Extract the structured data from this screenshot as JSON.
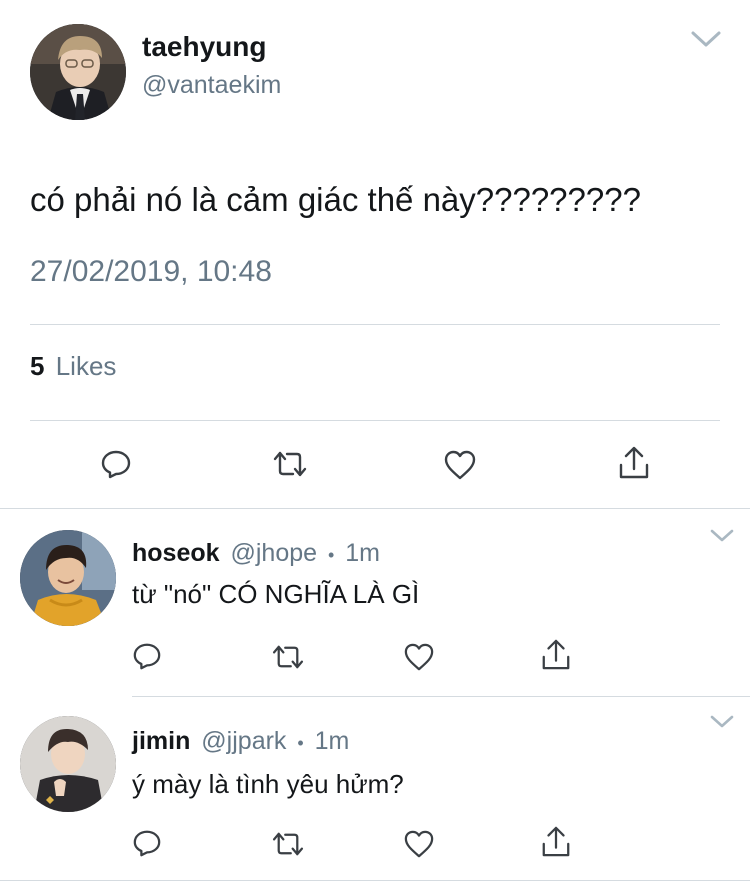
{
  "main_tweet": {
    "display_name": "taehyung",
    "handle": "@vantaekim",
    "text": "có phải nó là cảm giác thế này?????????",
    "timestamp": "27/02/2019, 10:48",
    "likes_count": "5",
    "likes_label": "Likes"
  },
  "replies": [
    {
      "display_name": "hoseok",
      "handle": "@jhope",
      "dot": "•",
      "time": "1m",
      "text": "từ \"nó\" CÓ NGHĨA LÀ GÌ"
    },
    {
      "display_name": "jimin",
      "handle": "@jjpark",
      "dot": "•",
      "time": "1m",
      "text": "ý mày là tình yêu hửm?"
    }
  ],
  "icons": [
    "chevron-down-icon",
    "reply-icon",
    "retweet-icon",
    "like-icon",
    "share-icon"
  ],
  "colors": {
    "text": "#14171a",
    "muted": "#657786",
    "icon": "#3a3f44",
    "chevron": "#aab8c2",
    "divider": "#d5dbe0"
  }
}
